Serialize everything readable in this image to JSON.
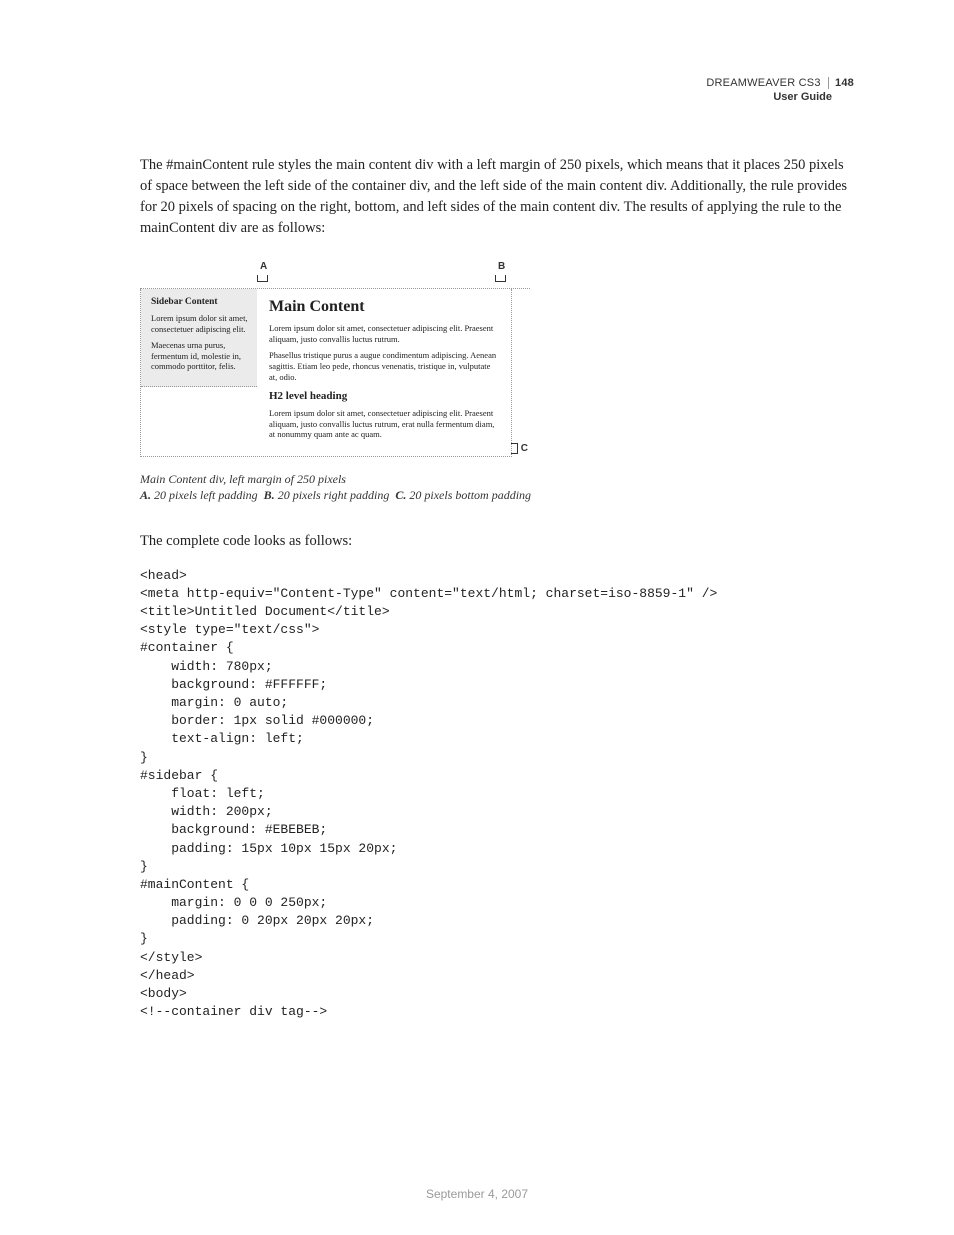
{
  "header": {
    "product": "DREAMWEAVER CS3",
    "page_number": "148",
    "subtitle": "User Guide"
  },
  "paragraph1": "The #mainContent rule styles the main content div with a left margin of 250 pixels, which means that it places 250 pixels of space between the left side of the container div, and the left side of the main content div. Additionally, the rule provides for 20 pixels of spacing on the right, bottom, and left sides of the main content div. The results of applying the rule to the mainContent div are as follows:",
  "figure": {
    "label_a": "A",
    "label_b": "B",
    "label_c": "C",
    "sidebar": {
      "heading": "Sidebar Content",
      "p1": "Lorem ipsum dolor sit amet, consectetuer adipiscing elit.",
      "p2": "Maecenas urna purus, fermentum id, molestie in, commodo porttitor, felis."
    },
    "main": {
      "h1": "Main Content",
      "p1": "Lorem ipsum dolor sit amet, consectetuer adipiscing elit. Praesent aliquam, justo convallis luctus rutrum.",
      "p2": "Phasellus tristique purus a augue condimentum adipiscing. Aenean sagittis. Etiam leo pede, rhoncus venenatis, tristique in, vulputate at, odio.",
      "h2": "H2 level heading",
      "p3": "Lorem ipsum dolor sit amet, consectetuer adipiscing elit. Praesent aliquam, justo convallis luctus rutrum, erat nulla fermentum diam, at nonummy quam ante ac quam."
    }
  },
  "caption": {
    "title": "Main Content div, left margin of 250 pixels",
    "a_label": "A.",
    "a_text": "20 pixels left padding",
    "b_label": "B.",
    "b_text": "20 pixels right padding",
    "c_label": "C.",
    "c_text": "20 pixels bottom padding"
  },
  "paragraph2": "The complete code looks as follows:",
  "code": "<head>\n<meta http-equiv=\"Content-Type\" content=\"text/html; charset=iso-8859-1\" />\n<title>Untitled Document</title>\n<style type=\"text/css\">\n#container {\n    width: 780px;\n    background: #FFFFFF;\n    margin: 0 auto;\n    border: 1px solid #000000;\n    text-align: left;\n}\n#sidebar {\n    float: left;\n    width: 200px;\n    background: #EBEBEB;\n    padding: 15px 10px 15px 20px;\n}\n#mainContent {\n    margin: 0 0 0 250px;\n    padding: 0 20px 20px 20px;\n}\n</style>\n</head>\n<body>\n<!--container div tag-->",
  "footer_date": "September 4, 2007"
}
